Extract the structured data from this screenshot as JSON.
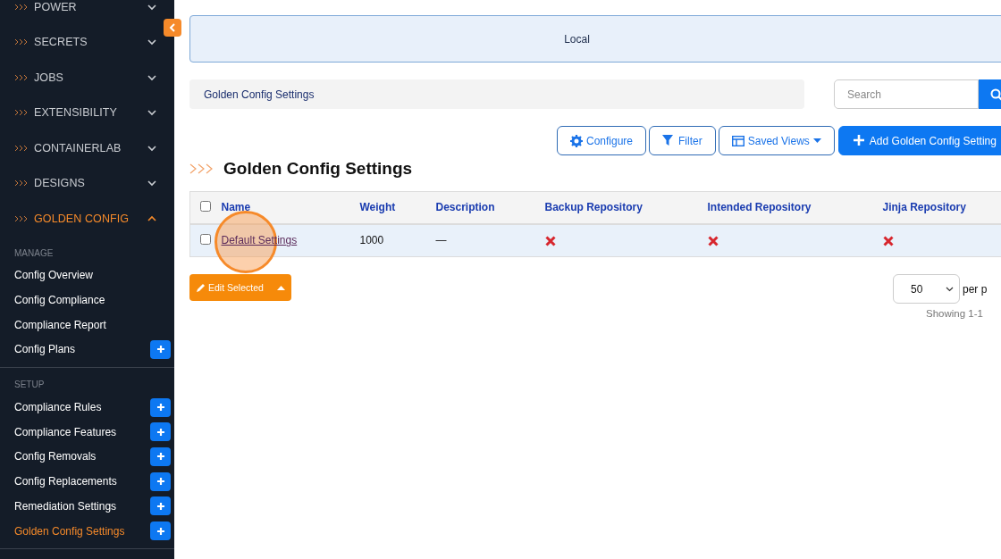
{
  "sidebar": {
    "sections": [
      {
        "label": "POWER",
        "expanded": false
      },
      {
        "label": "SECRETS",
        "expanded": false
      },
      {
        "label": "JOBS",
        "expanded": false
      },
      {
        "label": "EXTENSIBILITY",
        "expanded": false
      },
      {
        "label": "CONTAINERLAB",
        "expanded": false
      },
      {
        "label": "DESIGNS",
        "expanded": false
      },
      {
        "label": "GOLDEN CONFIG",
        "expanded": true,
        "groups": [
          {
            "heading": "MANAGE",
            "items": [
              {
                "label": "Config Overview",
                "selected": false,
                "addable": false
              },
              {
                "label": "Config Compliance",
                "selected": false,
                "addable": false
              },
              {
                "label": "Compliance Report",
                "selected": false,
                "addable": false
              },
              {
                "label": "Config Plans",
                "selected": false,
                "addable": true
              }
            ]
          },
          {
            "heading": "SETUP",
            "items": [
              {
                "label": "Compliance Rules",
                "selected": false,
                "addable": true
              },
              {
                "label": "Compliance Features",
                "selected": false,
                "addable": true
              },
              {
                "label": "Config Removals",
                "selected": false,
                "addable": true
              },
              {
                "label": "Config Replacements",
                "selected": false,
                "addable": true
              },
              {
                "label": "Remediation Settings",
                "selected": false,
                "addable": true
              },
              {
                "label": "Golden Config Settings",
                "selected": true,
                "addable": true
              }
            ]
          }
        ]
      }
    ]
  },
  "banner": {
    "text": "Local"
  },
  "breadcrumb": {
    "text": "Golden Config Settings"
  },
  "search": {
    "placeholder": "Search"
  },
  "toolbar": [
    {
      "label": "Configure",
      "kind": "configure"
    },
    {
      "label": "Filter",
      "kind": "filter"
    },
    {
      "label": "Saved Views",
      "kind": "saved-views"
    },
    {
      "label": "Add Golden Config Setting",
      "kind": "add"
    }
  ],
  "page_title": "Golden Config Settings",
  "table": {
    "select_all": {
      "checked": false
    },
    "columns": [
      "Name",
      "Weight",
      "Description",
      "Backup Repository",
      "Intended Repository",
      "Jinja Repository"
    ],
    "rows": [
      {
        "checked": false,
        "highlighted": true,
        "cells": [
          {
            "kind": "link",
            "text": "Default Settings",
            "click_marker": true
          },
          {
            "kind": "text",
            "text": "1000"
          },
          {
            "kind": "text",
            "text": "—"
          },
          {
            "kind": "boolean",
            "value": false
          },
          {
            "kind": "boolean",
            "value": false
          },
          {
            "kind": "boolean",
            "value": false
          }
        ]
      }
    ]
  },
  "bulk_button": {
    "label": "Edit Selected"
  },
  "pagination": {
    "per_page": "50",
    "per_page_label": "per p",
    "showing": "Showing 1-1"
  }
}
